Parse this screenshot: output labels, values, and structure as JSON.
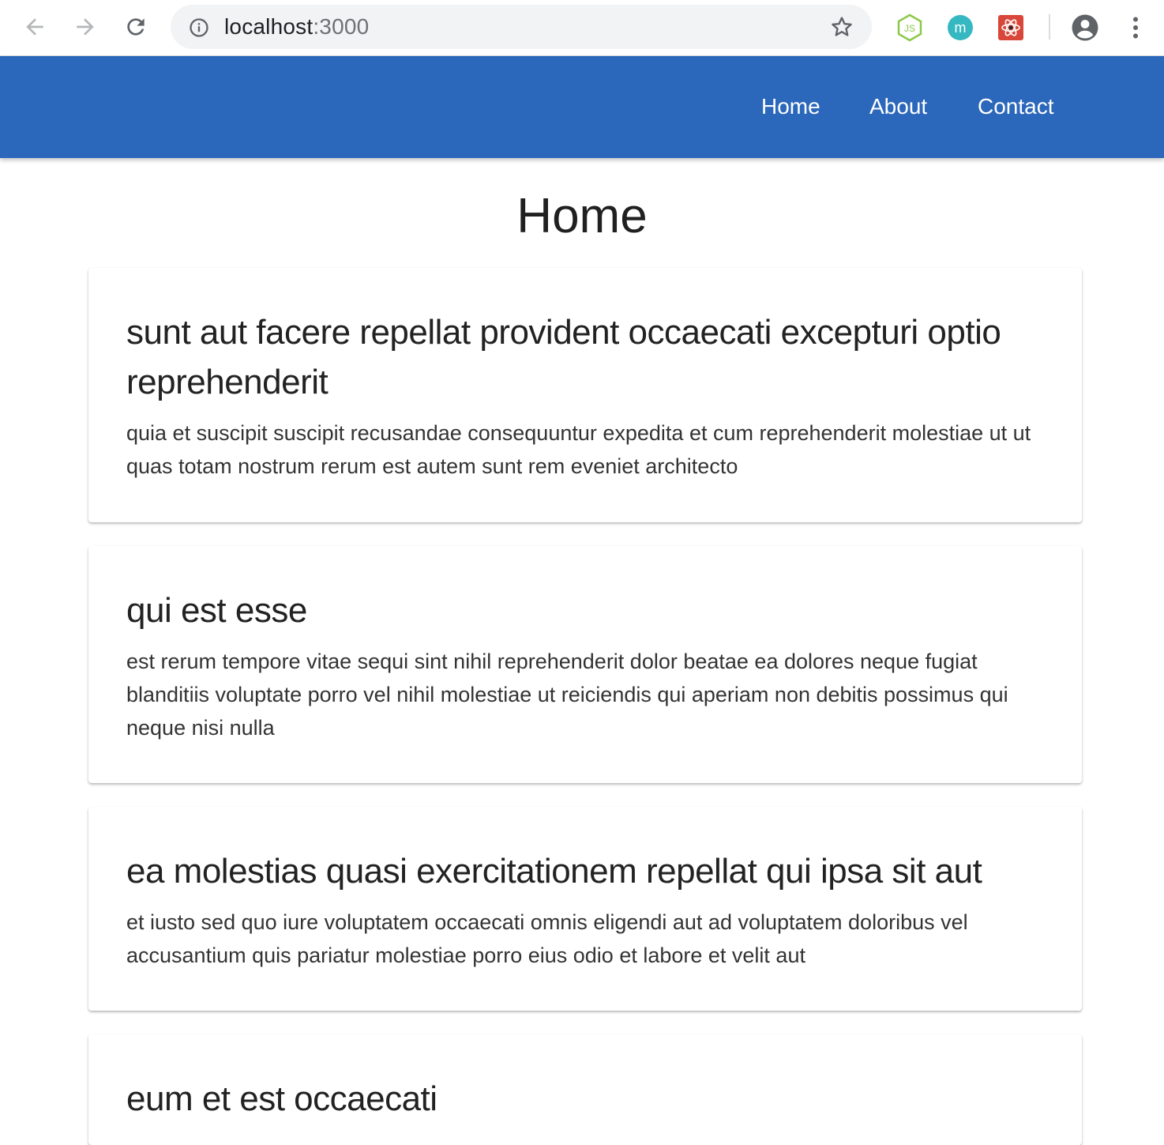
{
  "browser": {
    "url_host": "localhost",
    "url_port": ":3000",
    "icons": {
      "back": "arrow-left-icon",
      "forward": "arrow-right-icon",
      "reload": "reload-icon",
      "info": "info-icon",
      "bookmark": "star-icon",
      "ext_node": "nodejs-extension-icon",
      "ext_m": "m-extension-icon",
      "ext_react": "react-devtools-extension-icon",
      "profile": "profile-icon",
      "menu": "kebab-menu-icon"
    },
    "ext_m_letter": "m",
    "ext_node_letter": "JS"
  },
  "colors": {
    "appbar": "#2b67ba",
    "nav_text": "#ffffff"
  },
  "nav": {
    "items": [
      {
        "label": "Home"
      },
      {
        "label": "About"
      },
      {
        "label": "Contact"
      }
    ]
  },
  "page": {
    "title": "Home"
  },
  "posts": [
    {
      "title": "sunt aut facere repellat provident occaecati excepturi optio reprehenderit",
      "body": "quia et suscipit suscipit recusandae consequuntur expedita et cum reprehenderit molestiae ut ut quas totam nostrum rerum est autem sunt rem eveniet architecto"
    },
    {
      "title": "qui est esse",
      "body": "est rerum tempore vitae sequi sint nihil reprehenderit dolor beatae ea dolores neque fugiat blanditiis voluptate porro vel nihil molestiae ut reiciendis qui aperiam non debitis possimus qui neque nisi nulla"
    },
    {
      "title": "ea molestias quasi exercitationem repellat qui ipsa sit aut",
      "body": "et iusto sed quo iure voluptatem occaecati omnis eligendi aut ad voluptatem doloribus vel accusantium quis pariatur molestiae porro eius odio et labore et velit aut"
    },
    {
      "title": "eum et est occaecati",
      "body": ""
    }
  ]
}
